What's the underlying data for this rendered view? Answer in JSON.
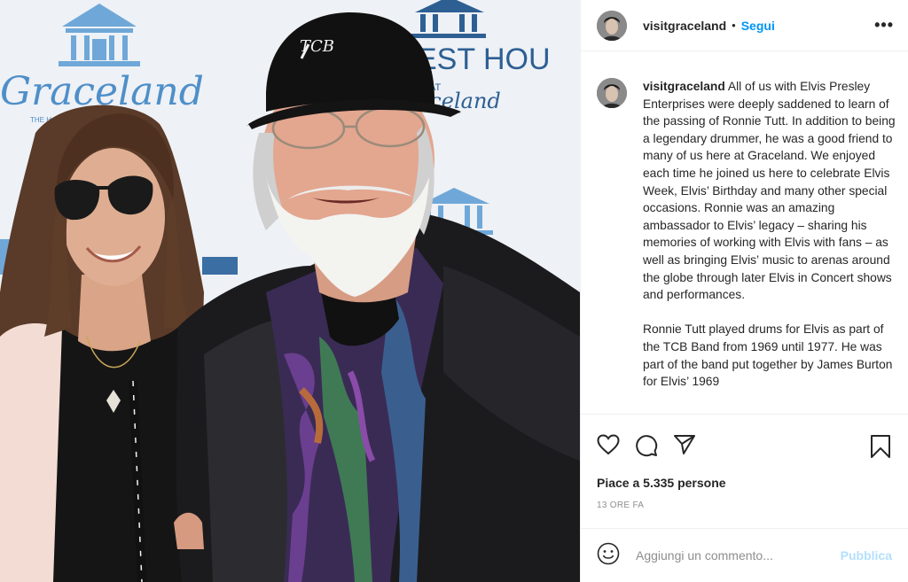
{
  "colors": {
    "accent": "#0095f6",
    "publish_disabled": "#b2dffc",
    "muted": "#8e8e8e",
    "text": "#262626"
  },
  "photo": {
    "backdrop_text": {
      "graceland": "Graceland",
      "graceland_sub": "THE H        ESLEY",
      "guest_house_top": "EST HOU",
      "guest_house_at": "AT",
      "guest_house_bottom": "aceland",
      "cap_logo": "TCB"
    }
  },
  "header": {
    "username": "visitgraceland",
    "separator": "•",
    "follow_label": "Segui",
    "more_icon": "more-dots-icon",
    "more_label": "•••"
  },
  "caption": {
    "username": "visitgraceland",
    "paragraph1": "All of us with Elvis Presley Enterprises were deeply saddened to learn of the passing of Ronnie Tutt. In addition to being a legendary drummer, he was a good friend to many of us here at Graceland. We enjoyed each time he joined us here to celebrate Elvis Week, Elvis’ Birthday and many other special occasions. Ronnie was an amazing ambassador to Elvis’ legacy – sharing his memories of working with Elvis with fans – as well as bringing Elvis’ music to arenas around the globe through later Elvis in Concert shows and performances.",
    "paragraph2": "Ronnie Tutt played drums for Elvis as part of the TCB Band from 1969 until 1977. He was part of the band put together by James Burton for Elvis’ 1969"
  },
  "actions": {
    "icons": [
      "heart-icon",
      "comment-icon",
      "share-icon",
      "bookmark-icon"
    ]
  },
  "likes_text": "Piace a 5.335 persone",
  "timestamp": "13 ORE FA",
  "comment": {
    "emoji_icon": "smiley-icon",
    "placeholder": "Aggiungi un commento...",
    "publish_label": "Pubblica"
  }
}
